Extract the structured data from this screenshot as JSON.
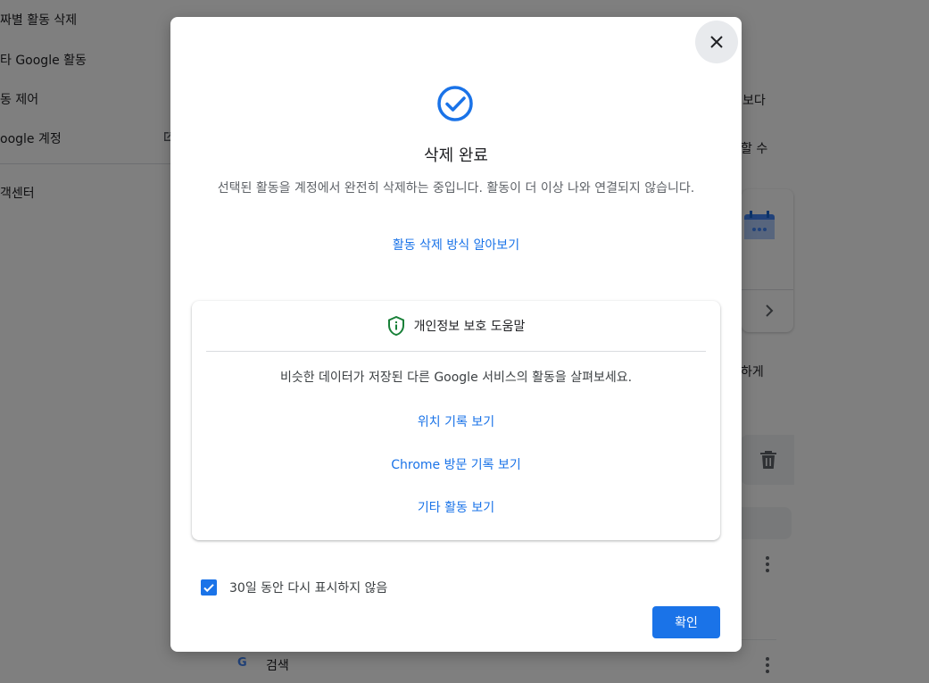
{
  "background": {
    "sidebar_items": [
      "짜별 활동 삭제",
      "타 Google 활동",
      "동 제어",
      "oogle 계정",
      "객센터"
    ],
    "right_texts": [
      "보다",
      "할 수",
      "하게"
    ],
    "search_label": "검색",
    "google_g": "G"
  },
  "dialog": {
    "title": "삭제 완료",
    "description": "선택된 활동을 계정에서 완전히 삭제하는 중입니다. 활동이 더 이상 나와 연결되지 않습니다.",
    "learn_link": "활동 삭제 방식 알아보기",
    "panel": {
      "heading": "개인정보 보호 도움말",
      "description": "비슷한 데이터가 저장된 다른 Google 서비스의 활동을 살펴보세요.",
      "links": [
        "위치 기록 보기",
        "Chrome 방문 기록 보기",
        "기타 활동 보기"
      ]
    },
    "checkbox_label": "30일 동안 다시 표시하지 않음",
    "checkbox_checked": true,
    "confirm_label": "확인"
  },
  "colors": {
    "accent": "#1a73e8",
    "shield": "#188038",
    "scrim": "rgba(0,0,0,0.5)"
  },
  "icons": [
    "close-icon",
    "check-circle-icon",
    "shield-info-icon",
    "checkmark-icon",
    "calendar-icon",
    "chevron-right-icon",
    "trash-icon",
    "more-vert-icon"
  ]
}
